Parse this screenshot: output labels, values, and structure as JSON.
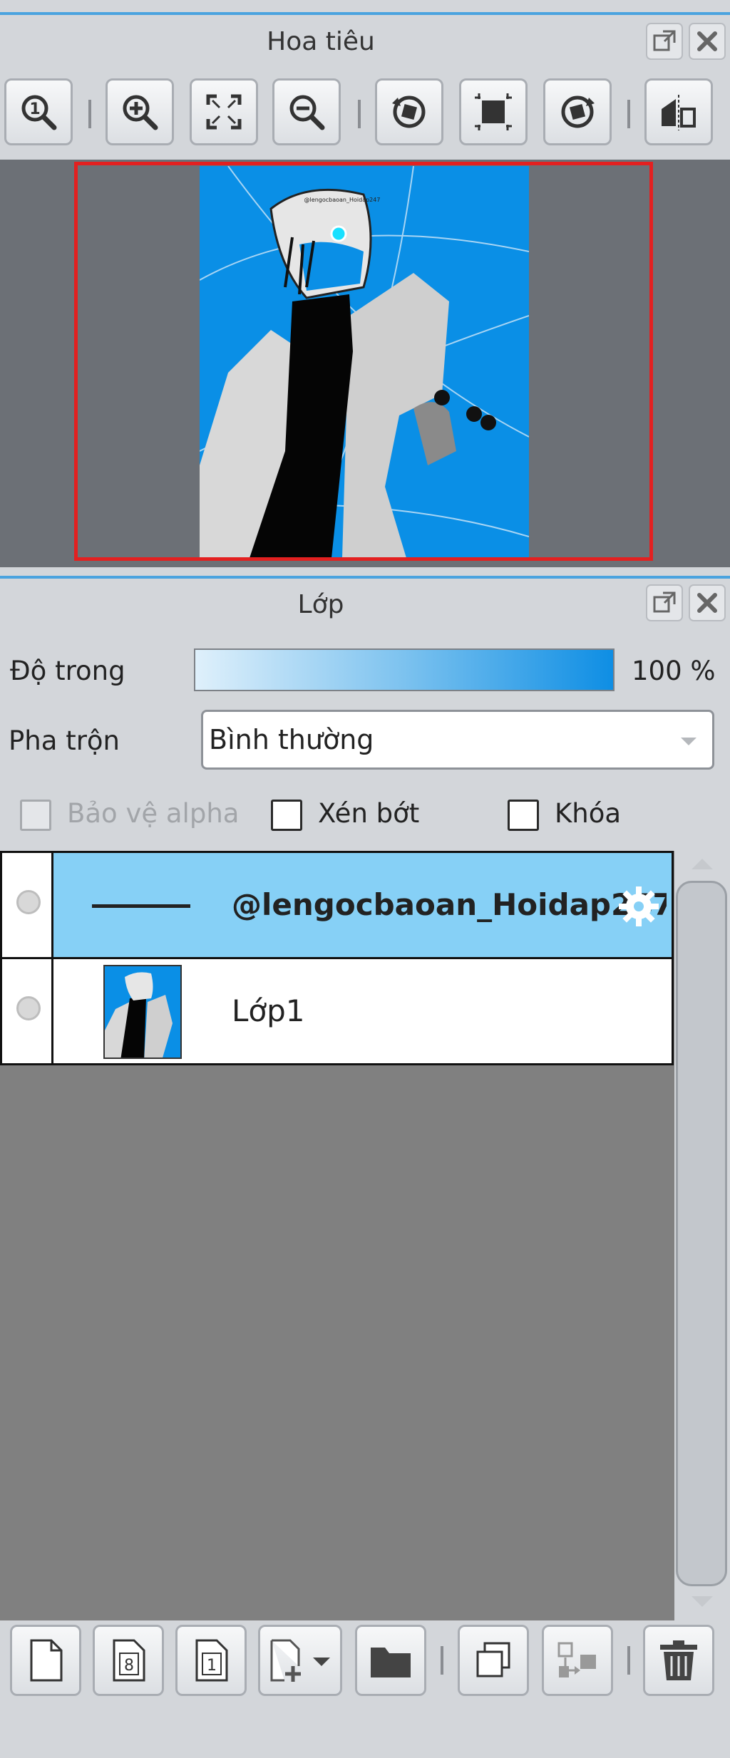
{
  "navigator": {
    "title": "Hoa tiêu",
    "tools": [
      {
        "icon": "zoom-actual-icon"
      },
      {
        "icon": "zoom-in-icon"
      },
      {
        "icon": "fit-to-window-icon"
      },
      {
        "icon": "zoom-out-icon"
      },
      {
        "icon": "rotate-left-icon"
      },
      {
        "icon": "reset-rotation-icon"
      },
      {
        "icon": "rotate-right-icon"
      },
      {
        "icon": "flip-horizontal-icon"
      }
    ],
    "preview_watermark": "@lengocbaoan_Hoidap247"
  },
  "layers_panel": {
    "title": "Lớp",
    "opacity_label": "Độ trong",
    "opacity_value": "100 %",
    "opacity_percent": 100,
    "blend_label": "Pha trộn",
    "blend_value": "Bình thường",
    "checkboxes": {
      "protect_alpha": "Bảo vệ alpha",
      "clipping": "Xén bớt",
      "lock": "Khóa"
    },
    "layers": [
      {
        "name": "@lengocbaoan_Hoidap247",
        "selected": true,
        "type": "text"
      },
      {
        "name": "Lớp1",
        "selected": false,
        "type": "raster"
      }
    ]
  },
  "bottom_toolbar": [
    {
      "icon": "new-layer-icon"
    },
    {
      "icon": "new-8bit-layer-icon"
    },
    {
      "icon": "new-1bit-layer-icon"
    },
    {
      "icon": "add-layer-dropdown-icon"
    },
    {
      "icon": "new-folder-icon"
    },
    {
      "icon": "duplicate-layer-icon"
    },
    {
      "icon": "merge-layer-icon"
    },
    {
      "icon": "delete-layer-icon"
    }
  ],
  "colors": {
    "accent": "#4aa3df",
    "selected_row": "#86d0f6",
    "nav_frame": "#e32020",
    "canvas_bg": "#0a8fe6"
  }
}
